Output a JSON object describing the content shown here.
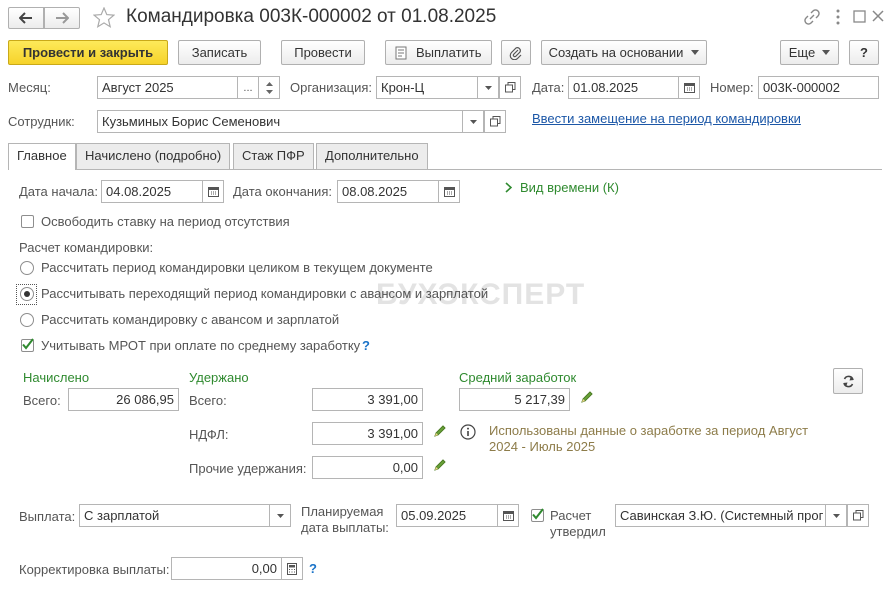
{
  "window": {
    "title": "Командировка 003К-000002 от 01.08.2025"
  },
  "toolbar": {
    "post_close": "Провести и закрыть",
    "save": "Записать",
    "post": "Провести",
    "pay": "Выплатить",
    "create_based": "Создать на основании",
    "more": "Еще",
    "help": "?"
  },
  "header": {
    "month_label": "Месяц:",
    "month_value": "Август 2025",
    "month_dots": "...",
    "org_label": "Организация:",
    "org_value": "Крон-Ц",
    "date_label": "Дата:",
    "date_value": "01.08.2025",
    "number_label": "Номер:",
    "number_value": "003К-000002",
    "employee_label": "Сотрудник:",
    "employee_value": "Кузьминых Борис Семенович",
    "replace_link": "Ввести замещение на период командировки"
  },
  "tabs": [
    "Главное",
    "Начислено (подробно)",
    "Стаж ПФР",
    "Дополнительно"
  ],
  "main": {
    "start_label": "Дата начала:",
    "start_value": "04.08.2025",
    "end_label": "Дата окончания:",
    "end_value": "08.08.2025",
    "time_kind": "Вид времени (К)",
    "release_rate": "Освободить ставку на период отсутствия",
    "calc_label": "Расчет командировки:",
    "radio1": "Рассчитать период командировки целиком в текущем документе",
    "radio2": "Рассчитывать переходящий период командировки с авансом и зарплатой",
    "radio3": "Рассчитать командировку с авансом и зарплатой",
    "mrot": "Учитывать МРОТ при оплате по среднему заработку",
    "mrot_help": "?",
    "watermark": "БУХЭКСПЕРТ"
  },
  "amounts": {
    "accrued_title": "Начислено",
    "accrued_total_label": "Всего:",
    "accrued_total": "26 086,95",
    "withheld_title": "Удержано",
    "withheld_total_label": "Всего:",
    "withheld_total": "3 391,00",
    "ndfl_label": "НДФЛ:",
    "ndfl": "3 391,00",
    "other_label": "Прочие удержания:",
    "other": "0,00",
    "avg_title": "Средний заработок",
    "avg_value": "5 217,39",
    "info_line1": "Использованы данные о заработке за период Август",
    "info_line2": "2024 - Июль 2025"
  },
  "payment": {
    "label": "Выплата:",
    "value": "С зарплатой",
    "planned_label1": "Планируемая",
    "planned_label2": "дата выплаты:",
    "planned_value": "05.09.2025",
    "approved_label1": "Расчет",
    "approved_label2": "утвердил",
    "approved_value": "Савинская З.Ю. (Системный прог",
    "correction_label": "Корректировка выплаты:",
    "correction_value": "0,00",
    "correction_help": "?"
  }
}
